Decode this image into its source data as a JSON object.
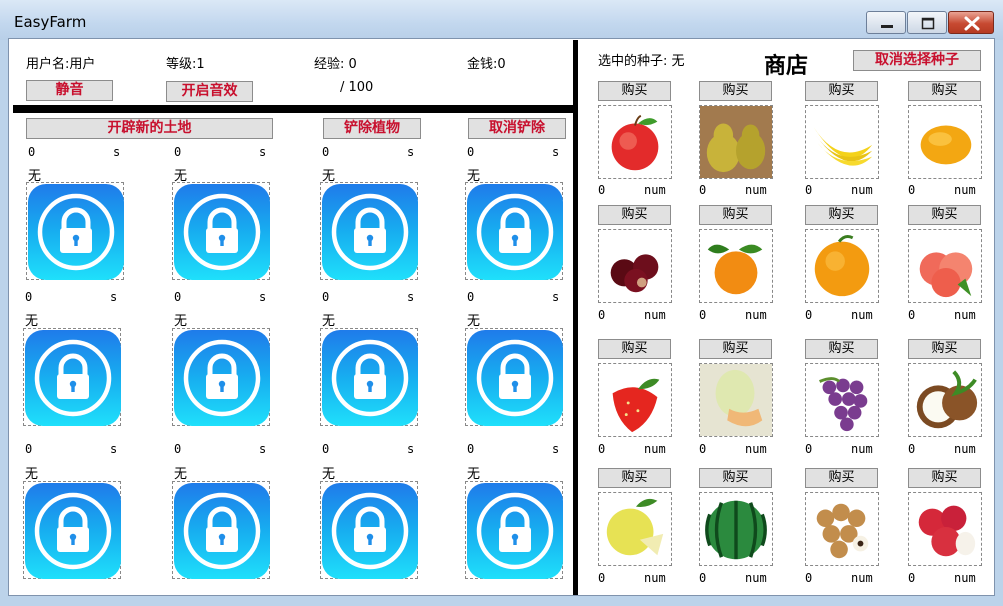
{
  "window": {
    "title": "EasyFarm"
  },
  "header": {
    "username_label": "用户名:用户",
    "level_label": "等级:1",
    "exp_label": "经验: 0",
    "exp_max_label": "/ 100",
    "money_label": "金钱:0",
    "mute_button": "静音",
    "sound_button": "开启音效"
  },
  "farm": {
    "toolbar": {
      "open_land": "开辟新的土地",
      "remove_plant": "铲除植物",
      "cancel_remove": "取消铲除"
    },
    "plots": [
      {
        "time": "0",
        "unit": "s",
        "crop": "无",
        "state": "locked"
      },
      {
        "time": "0",
        "unit": "s",
        "crop": "无",
        "state": "locked"
      },
      {
        "time": "0",
        "unit": "s",
        "crop": "无",
        "state": "locked"
      },
      {
        "time": "0",
        "unit": "s",
        "crop": "无",
        "state": "locked"
      },
      {
        "time": "0",
        "unit": "s",
        "crop": "无",
        "state": "locked"
      },
      {
        "time": "0",
        "unit": "s",
        "crop": "无",
        "state": "locked"
      },
      {
        "time": "0",
        "unit": "s",
        "crop": "无",
        "state": "locked"
      },
      {
        "time": "0",
        "unit": "s",
        "crop": "无",
        "state": "locked"
      },
      {
        "time": "0",
        "unit": "s",
        "crop": "无",
        "state": "locked"
      },
      {
        "time": "0",
        "unit": "s",
        "crop": "无",
        "state": "locked"
      },
      {
        "time": "0",
        "unit": "s",
        "crop": "无",
        "state": "locked"
      },
      {
        "time": "0",
        "unit": "s",
        "crop": "无",
        "state": "locked"
      }
    ],
    "lock_icon_name": "lock-icon"
  },
  "shop": {
    "selected_seed_label": "选中的种子: 无",
    "title": "商店",
    "cancel_select_button": "取消选择种子",
    "buy_label": "购买",
    "items": [
      {
        "fruit": "apple-icon",
        "count": "0",
        "unit": "num"
      },
      {
        "fruit": "pear-icon",
        "count": "0",
        "unit": "num"
      },
      {
        "fruit": "banana-icon",
        "count": "0",
        "unit": "num"
      },
      {
        "fruit": "mango-icon",
        "count": "0",
        "unit": "num"
      },
      {
        "fruit": "cherry-icon",
        "count": "0",
        "unit": "num"
      },
      {
        "fruit": "tangerine-icon",
        "count": "0",
        "unit": "num"
      },
      {
        "fruit": "orange-icon",
        "count": "0",
        "unit": "num"
      },
      {
        "fruit": "peach-icon",
        "count": "0",
        "unit": "num"
      },
      {
        "fruit": "strawberry-icon",
        "count": "0",
        "unit": "num"
      },
      {
        "fruit": "melon-icon",
        "count": "0",
        "unit": "num"
      },
      {
        "fruit": "grape-icon",
        "count": "0",
        "unit": "num"
      },
      {
        "fruit": "coconut-icon",
        "count": "0",
        "unit": "num"
      },
      {
        "fruit": "pomelo-icon",
        "count": "0",
        "unit": "num"
      },
      {
        "fruit": "watermelon-icon",
        "count": "0",
        "unit": "num"
      },
      {
        "fruit": "longan-icon",
        "count": "0",
        "unit": "num"
      },
      {
        "fruit": "lychee-icon",
        "count": "0",
        "unit": "num"
      }
    ]
  },
  "colors": {
    "accent_red": "#c8102e",
    "lock_top": "#1f7bea",
    "lock_bottom": "#1fe0fb"
  }
}
